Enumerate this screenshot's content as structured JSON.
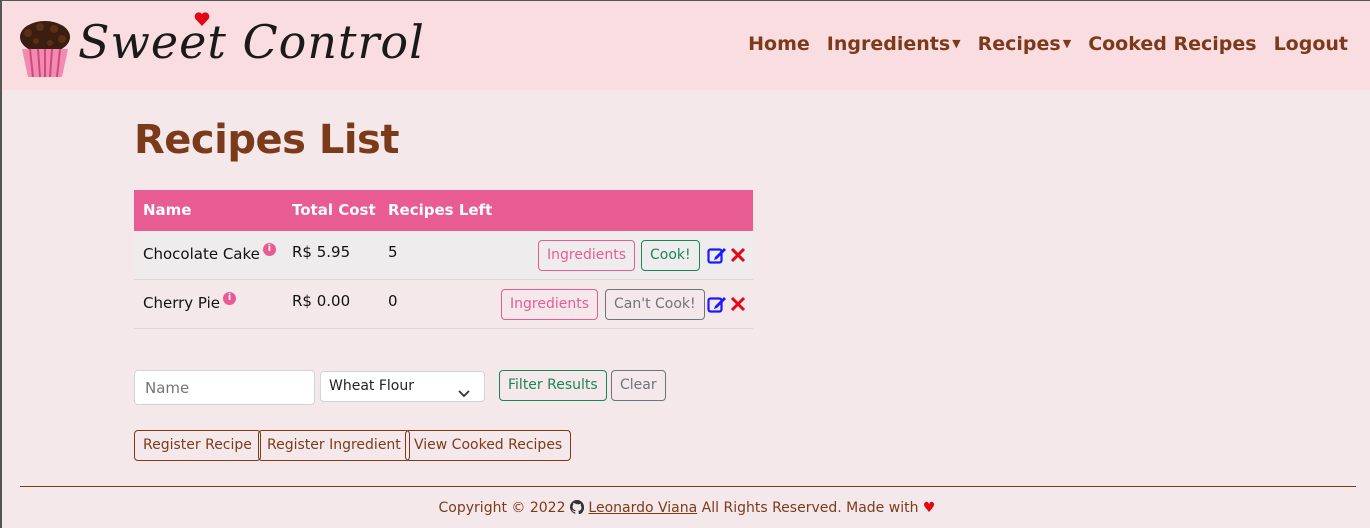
{
  "brand": {
    "title": "Sweet Control"
  },
  "nav": {
    "home": "Home",
    "ingredients": "Ingredients",
    "recipes": "Recipes",
    "cooked_recipes": "Cooked Recipes",
    "logout": "Logout"
  },
  "page": {
    "title": "Recipes List"
  },
  "table": {
    "headers": {
      "name": "Name",
      "total_cost": "Total Cost",
      "recipes_left": "Recipes Left"
    },
    "rows": [
      {
        "name": "Chocolate Cake",
        "total_cost": "R$ 5.95",
        "recipes_left": "5",
        "ingredients_label": "Ingredients",
        "cook_label": "Cook!"
      },
      {
        "name": "Cherry Pie",
        "total_cost": "R$ 0.00",
        "recipes_left": "0",
        "ingredients_label": "Ingredients",
        "cook_label": "Can't Cook!"
      }
    ]
  },
  "filter": {
    "name_placeholder": "Name",
    "ingredient_selected": "Wheat Flour",
    "filter_label": "Filter Results",
    "clear_label": "Clear"
  },
  "actions": {
    "register_recipe": "Register Recipe",
    "register_ingredient": "Register Ingredient",
    "view_cooked": "View Cooked Recipes"
  },
  "footer": {
    "copyright": "Copyright",
    "year": "2022",
    "author": "Leonardo Viana",
    "rights": "All Rights Reserved. Made with"
  },
  "colors": {
    "accent_pink": "#e95b93",
    "brand_brown": "#7b3b1b",
    "navbar_bg": "#f9dde1",
    "page_bg": "#f5e8ea"
  },
  "icons": [
    "cupcake-logo-icon",
    "heart-icon",
    "edit-icon",
    "delete-icon",
    "info-icon",
    "chevron-down-icon",
    "copyright-icon",
    "github-icon"
  ]
}
